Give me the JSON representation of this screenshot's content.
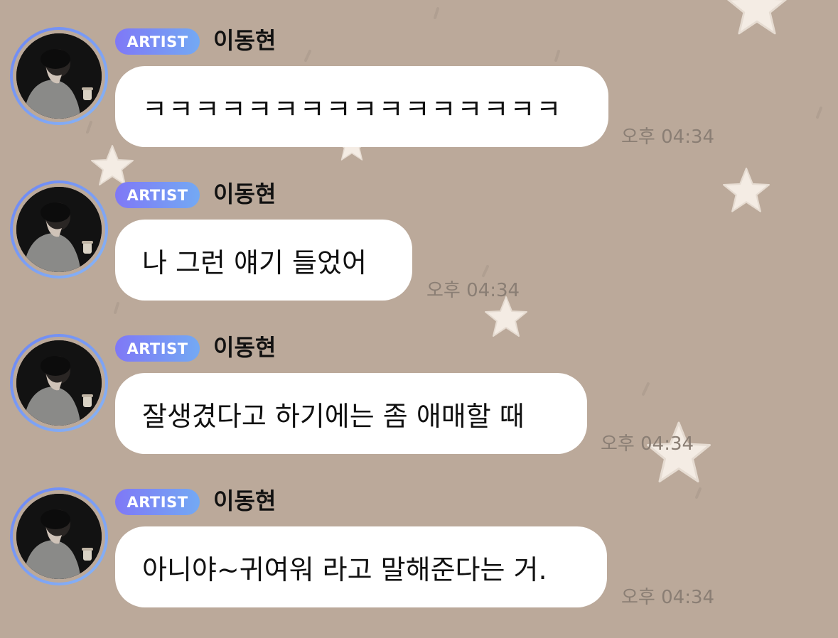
{
  "chat": {
    "messages": [
      {
        "badge": "ARTIST",
        "sender": "이동현",
        "text": "ㅋㅋㅋㅋㅋㅋㅋㅋㅋㅋㅋㅋㅋㅋㅋㅋ",
        "time": "오후 04:34"
      },
      {
        "badge": "ARTIST",
        "sender": "이동현",
        "text": "나 그런 얘기 들었어",
        "time": "오후 04:34"
      },
      {
        "badge": "ARTIST",
        "sender": "이동현",
        "text": "잘생겼다고 하기에는 좀 애매할 때",
        "time": "오후 04:34"
      },
      {
        "badge": "ARTIST",
        "sender": "이동현",
        "text": "아니야~귀여워 라고 말해준다는 거.",
        "time": "오후 04:34"
      }
    ]
  },
  "colors": {
    "background": "#bba99a",
    "bubble": "#ffffff",
    "badge_gradient_start": "#7f78f6",
    "badge_gradient_end": "#73a9f4",
    "timestamp": "#8a7e74"
  },
  "icons": {
    "background_decoration": "star-icon"
  }
}
